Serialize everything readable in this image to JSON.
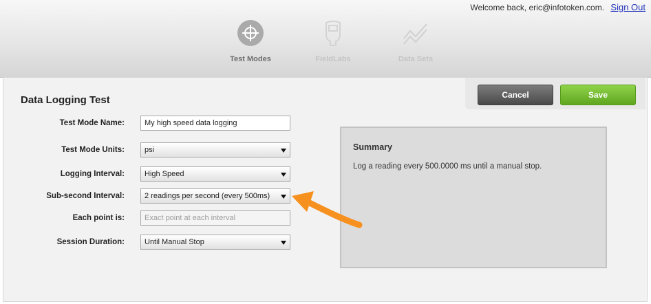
{
  "header": {
    "welcome_text": "Welcome back, eric@infotoken.com.",
    "sign_out_label": "Sign Out",
    "nav": [
      {
        "label": "Test Modes",
        "icon": "crosshair-icon",
        "active": true
      },
      {
        "label": "FieldLabs",
        "icon": "fieldlab-device-icon",
        "active": false
      },
      {
        "label": "Data Sets",
        "icon": "line-graph-icon",
        "active": false
      }
    ]
  },
  "form": {
    "title": "Data Logging Test",
    "fields": {
      "test_mode_name": {
        "label": "Test Mode Name:",
        "value": "My high speed data logging"
      },
      "test_mode_units": {
        "label": "Test Mode Units:",
        "value": "psi"
      },
      "logging_interval": {
        "label": "Logging Interval:",
        "value": "High Speed"
      },
      "sub_second_interval": {
        "label": "Sub-second Interval:",
        "value": "2 readings per second (every 500ms)"
      },
      "each_point_is": {
        "label": "Each point is:",
        "value": "Exact point at each interval"
      },
      "session_duration": {
        "label": "Session Duration:",
        "value": "Until Manual Stop"
      }
    }
  },
  "actions": {
    "cancel_label": "Cancel",
    "save_label": "Save"
  },
  "summary": {
    "title": "Summary",
    "text": "Log a reading every 500.0000 ms until a manual stop."
  },
  "colors": {
    "annotation_arrow": "#f6901e",
    "save_button": "#6db52c",
    "cancel_button": "#5a5a5a",
    "link": "#2233bb"
  }
}
